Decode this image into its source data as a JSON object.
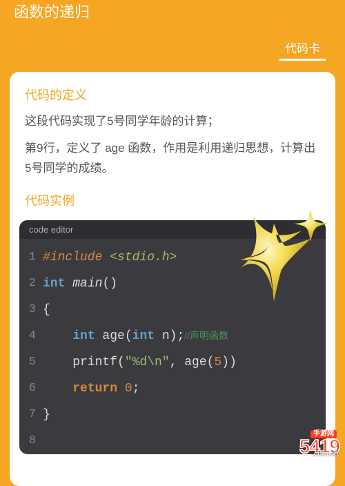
{
  "header": {
    "title": "函数的递归"
  },
  "tabs": {
    "active": "代码卡"
  },
  "card": {
    "def_title": "代码的定义",
    "def_p1": "这段代码实现了5号同学年龄的计算；",
    "def_p2": "第9行，定义了 age 函数，作用是利用递归思想，计算出5号同学的成绩。",
    "example_title": "代码实例"
  },
  "editor": {
    "header": "code editor",
    "lines": [
      {
        "n": "1",
        "tokens": [
          [
            "include",
            "#include "
          ],
          [
            "header",
            "<stdio.h>"
          ]
        ]
      },
      {
        "n": "2",
        "tokens": [
          [
            "keyword",
            "int "
          ],
          [
            "func",
            "main"
          ],
          [
            "paren",
            "()"
          ]
        ]
      },
      {
        "n": "3",
        "tokens": [
          [
            "plain",
            "{"
          ]
        ]
      },
      {
        "n": "4",
        "tokens": [
          [
            "plain",
            "    "
          ],
          [
            "keyword",
            "int"
          ],
          [
            "plain",
            " age("
          ],
          [
            "keyword",
            "int"
          ],
          [
            "plain",
            " n);"
          ],
          [
            "comment",
            "//声明函数"
          ]
        ]
      },
      {
        "n": "5",
        "tokens": [
          [
            "plain",
            "    printf("
          ],
          [
            "string",
            "\"%d\\n\""
          ],
          [
            "plain",
            ", age("
          ],
          [
            "num",
            "5"
          ],
          [
            "plain",
            "))"
          ]
        ]
      },
      {
        "n": "6",
        "tokens": [
          [
            "plain",
            "    "
          ],
          [
            "return",
            "return"
          ],
          [
            "plain",
            " "
          ],
          [
            "num",
            "0"
          ],
          [
            "plain",
            ";"
          ]
        ]
      },
      {
        "n": "7",
        "tokens": [
          [
            "plain",
            "}"
          ]
        ]
      },
      {
        "n": "8",
        "tokens": [
          [
            "plain",
            " "
          ]
        ]
      }
    ]
  },
  "watermark": {
    "main": "5419",
    "sub": ".com.cn",
    "tag": "手游网"
  }
}
